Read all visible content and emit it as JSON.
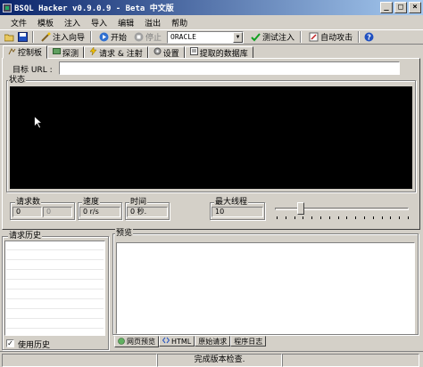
{
  "window": {
    "title": "BSQL Hacker v0.9.0.9 - Beta 中文版",
    "buttons": [
      "_",
      "□",
      "×"
    ]
  },
  "menu": [
    "文件",
    "模板",
    "注入",
    "导入",
    "编辑",
    "溢出",
    "帮助"
  ],
  "toolbar": {
    "inject_wizard": "注入向导",
    "start": "开始",
    "stop": "停止",
    "db_select": "ORACLE",
    "test_inject": "测试注入",
    "auto_attack": "自动攻击"
  },
  "tabs": [
    "控制板",
    "探测",
    "请求 & 注射",
    "设置",
    "提取的数据库"
  ],
  "control": {
    "url_label": "目标 URL :",
    "url_value": "",
    "status_title": "状态"
  },
  "stats": {
    "requests_label": "请求数",
    "requests_value": "0",
    "requests_value2": "0",
    "speed_label": "速度",
    "speed_value": "0 r/s",
    "time_label": "时间",
    "time_value": "0 秒.",
    "threads_label": "最大线程",
    "threads_value": "10"
  },
  "history": {
    "title": "请求历史",
    "use_history_label": "使用历史",
    "use_history_checked": true
  },
  "preview": {
    "title": "预览",
    "tabs": [
      "网页预览",
      "HTML",
      "原始请求",
      "程序日志"
    ]
  },
  "statusbar": {
    "message": "完成版本检查."
  },
  "colors": {
    "title_start": "#0a246a",
    "title_end": "#a6caf0",
    "face": "#d4d0c8",
    "status_screen": "#000000"
  }
}
